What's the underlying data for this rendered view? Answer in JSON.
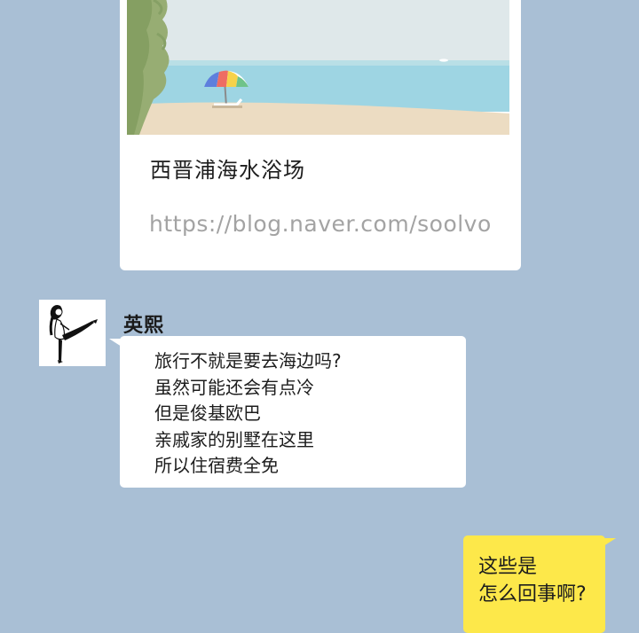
{
  "link_preview": {
    "title": "西晋浦海水浴场",
    "url": "https://blog.naver.com/soolvo"
  },
  "message_in": {
    "sender": "英熙",
    "lines": [
      "旅行不就是要去海边吗?",
      "虽然可能还会有点冷",
      "但是俊基欧巴",
      "亲戚家的别墅在这里",
      "所以住宿费全免"
    ]
  },
  "message_out": {
    "lines": [
      "这些是",
      "怎么回事啊?"
    ]
  },
  "colors": {
    "chat_background": "#a9bfd5",
    "incoming_bubble": "#ffffff",
    "outgoing_bubble": "#fde84a",
    "url_text": "#a3a3a3"
  }
}
